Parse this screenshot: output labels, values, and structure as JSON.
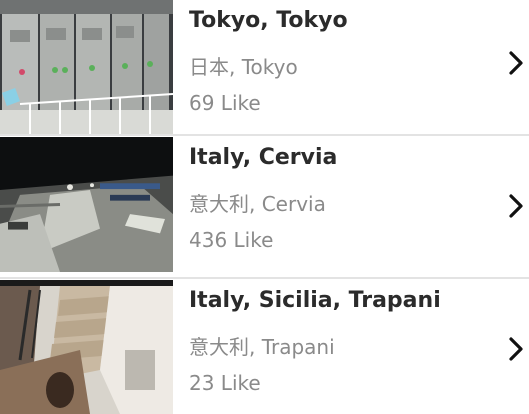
{
  "list": {
    "items": [
      {
        "title": "Tokyo, Tokyo",
        "subtitle": "日本, Tokyo",
        "likes": "69 Like",
        "thumbnail_icon": "electrical-panel-camera-thumbnail",
        "action_icon": "chevron-right-icon"
      },
      {
        "title": "Italy, Cervia",
        "subtitle": "意大利, Cervia",
        "likes": "436 Like",
        "thumbnail_icon": "night-beach-camera-thumbnail",
        "action_icon": "chevron-right-icon"
      },
      {
        "title": "Italy, Sicilia, Trapani",
        "subtitle": "意大利, Trapani",
        "likes": "23 Like",
        "thumbnail_icon": "stairway-camera-thumbnail",
        "action_icon": "chevron-right-icon"
      }
    ]
  },
  "colors": {
    "title": "#2b2b2b",
    "secondary_text": "#8a8a8a",
    "divider": "#e3e3e3",
    "chevron": "#111111"
  }
}
